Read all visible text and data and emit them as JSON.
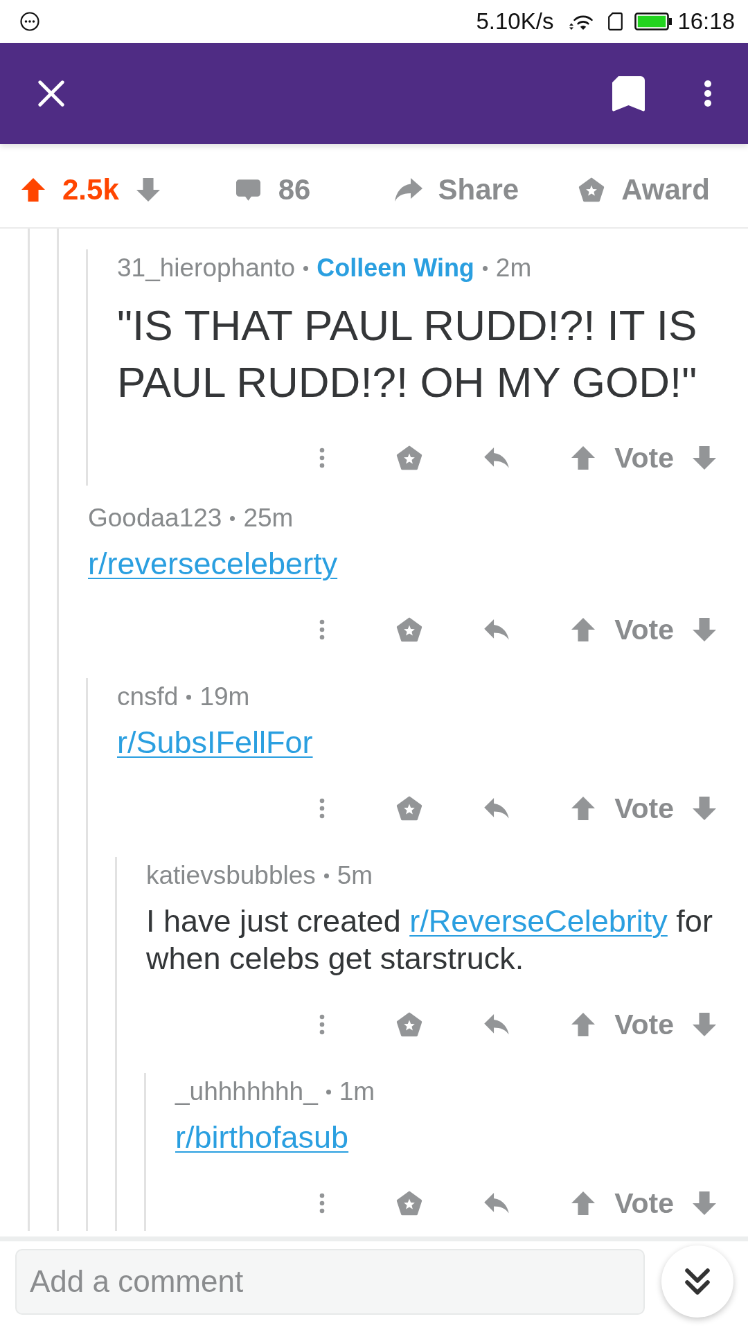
{
  "status_bar": {
    "network_speed": "5.10K/s",
    "time": "16:18"
  },
  "post_actions": {
    "upvoted": true,
    "score": "2.5k",
    "comment_count": "86",
    "share_label": "Share",
    "award_label": "Award"
  },
  "comments": [
    {
      "children": [
        {
          "children": [
            {
              "author": "31_hierophanto",
              "flair": "Colleen Wing",
              "age": "2m",
              "body": {
                "kind": "heading",
                "segments": [
                  {
                    "kind": "text",
                    "text": "\"IS THAT PAUL RUDD!?! IT IS PAUL RUDD!?! OH MY GOD!\""
                  }
                ]
              },
              "vote_label": "Vote"
            }
          ]
        },
        {
          "author": "Goodaa123",
          "age": "25m",
          "body": {
            "kind": "paragraph",
            "segments": [
              {
                "kind": "link",
                "text": "r/reverseceleberty"
              }
            ]
          },
          "vote_label": "Vote",
          "children": [
            {
              "author": "cnsfd",
              "age": "19m",
              "body": {
                "kind": "paragraph",
                "segments": [
                  {
                    "kind": "link",
                    "text": "r/SubsIFellFor"
                  }
                ]
              },
              "vote_label": "Vote",
              "children": [
                {
                  "author": "katievsbubbles",
                  "age": "5m",
                  "body": {
                    "kind": "paragraph",
                    "segments": [
                      {
                        "kind": "text",
                        "text": "I have just created "
                      },
                      {
                        "kind": "link",
                        "text": "r/ReverseCelebrity"
                      },
                      {
                        "kind": "text",
                        "text": " for when celebs get starstruck."
                      }
                    ]
                  },
                  "vote_label": "Vote",
                  "children": [
                    {
                      "author": "_uhhhhhhh_",
                      "age": "1m",
                      "body": {
                        "kind": "paragraph",
                        "segments": [
                          {
                            "kind": "link",
                            "text": "r/birthofasub"
                          }
                        ]
                      },
                      "vote_label": "Vote"
                    }
                  ]
                }
              ]
            }
          ]
        }
      ]
    }
  ],
  "comment_box": {
    "placeholder": "Add a comment"
  }
}
